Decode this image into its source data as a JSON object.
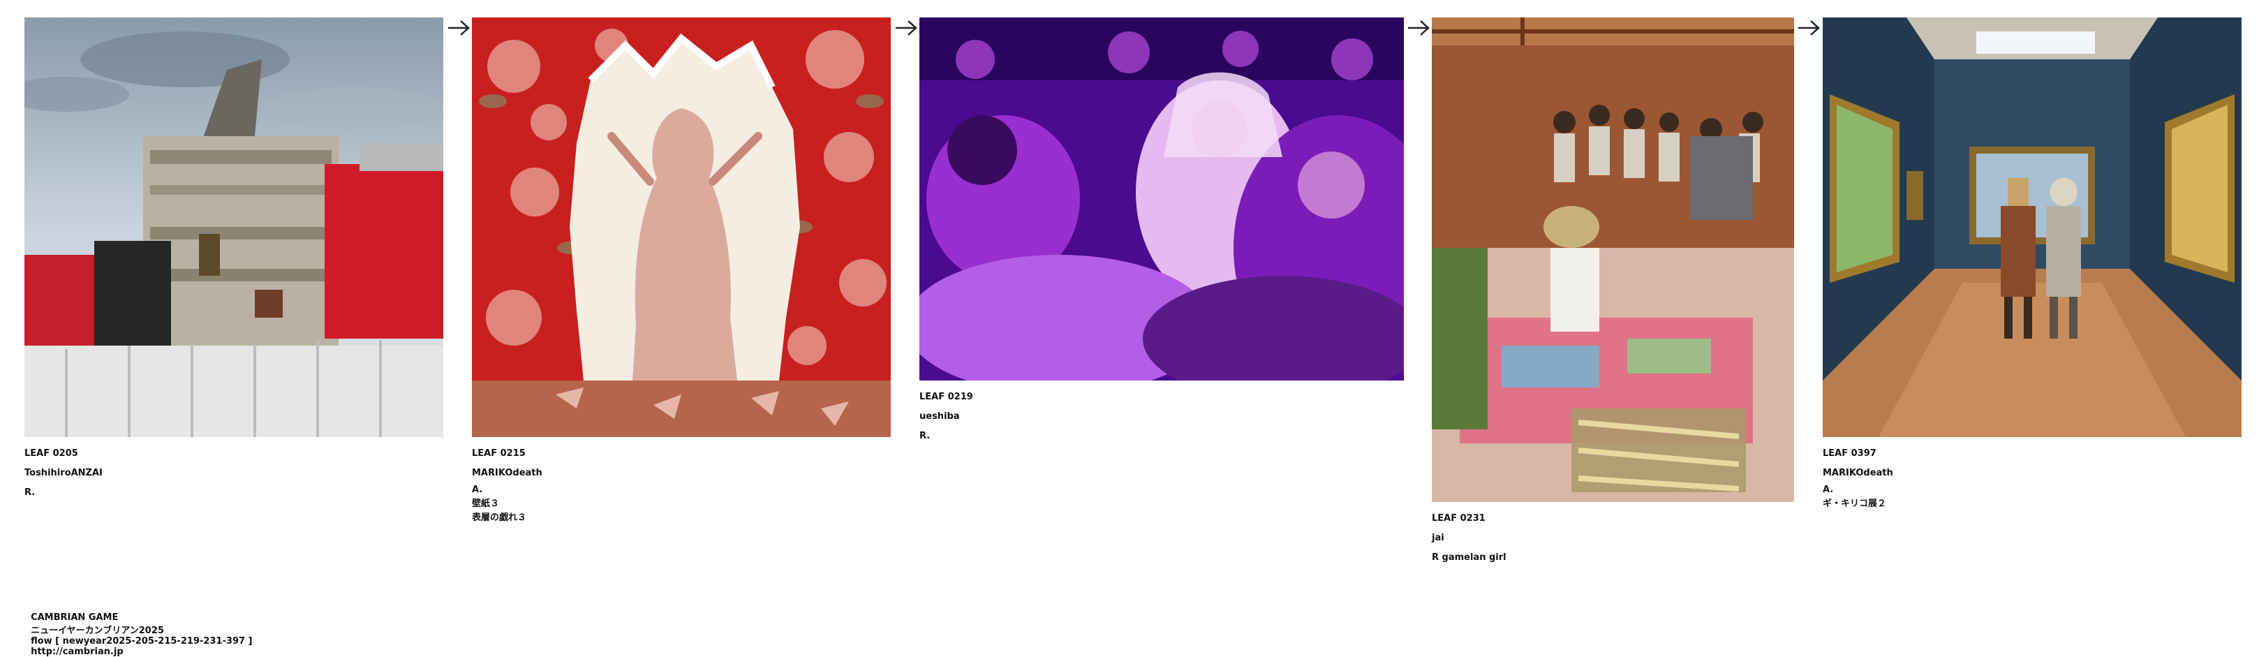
{
  "leaves": [
    {
      "id": "LEAF 0205",
      "author": "ToshihiroANZAI",
      "mark": "R.",
      "notes": [],
      "image": "demolished-building-photo"
    },
    {
      "id": "LEAF 0215",
      "author": "MARIKOdeath",
      "mark": "A.",
      "notes": [
        "壁紙３",
        "表層の戯れ３"
      ],
      "image": "woman-through-torn-floral-wallpaper"
    },
    {
      "id": "LEAF 0219",
      "author": "ueshiba",
      "mark": "R.",
      "notes": [],
      "image": "purple-lit-wedding-celebration"
    },
    {
      "id": "LEAF 0231",
      "author": "jai",
      "mark": "R gamelan girl",
      "notes": [],
      "image": "gamelan-room-with-girl"
    },
    {
      "id": "LEAF 0397",
      "author": "MARIKOdeath",
      "mark": "A.",
      "notes": [
        "ギ・キリコ展２"
      ],
      "image": "gallery-two-figures-paintings"
    }
  ],
  "arrow_glyph": "→",
  "footer": {
    "game": "CAMBRIAN GAME",
    "event": "ニューイヤーカンブリアン2025",
    "flow": "flow [ newyear2025-205-215-219-231-397 ]",
    "url": "http://cambrian.jp"
  },
  "colors": {
    "arrow": "#222222",
    "text": "#111111"
  }
}
